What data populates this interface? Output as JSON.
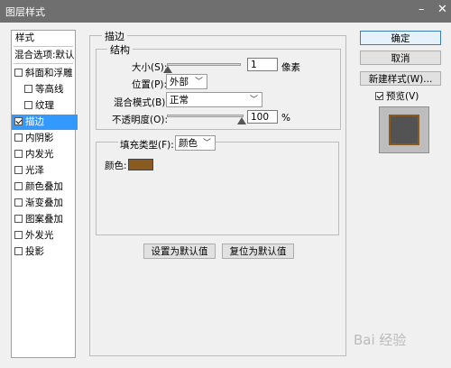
{
  "window": {
    "title": "图层样式",
    "minimize_glyph": "–",
    "close_glyph": "✕"
  },
  "sidebar": {
    "header": "样式",
    "blend_options": "混合选项:默认",
    "items": [
      {
        "label": "斜面和浮雕",
        "checked": false,
        "sub": false,
        "selected": false
      },
      {
        "label": "等高线",
        "checked": false,
        "sub": true,
        "selected": false
      },
      {
        "label": "纹理",
        "checked": false,
        "sub": true,
        "selected": false
      },
      {
        "label": "描边",
        "checked": true,
        "sub": false,
        "selected": true
      },
      {
        "label": "内阴影",
        "checked": false,
        "sub": false,
        "selected": false
      },
      {
        "label": "内发光",
        "checked": false,
        "sub": false,
        "selected": false
      },
      {
        "label": "光泽",
        "checked": false,
        "sub": false,
        "selected": false
      },
      {
        "label": "颜色叠加",
        "checked": false,
        "sub": false,
        "selected": false
      },
      {
        "label": "渐变叠加",
        "checked": false,
        "sub": false,
        "selected": false
      },
      {
        "label": "图案叠加",
        "checked": false,
        "sub": false,
        "selected": false
      },
      {
        "label": "外发光",
        "checked": false,
        "sub": false,
        "selected": false
      },
      {
        "label": "投影",
        "checked": false,
        "sub": false,
        "selected": false
      }
    ]
  },
  "stroke": {
    "section_title": "描边",
    "structure_title": "结构",
    "size_label": "大小(S):",
    "size_value": "1",
    "size_unit": "像素",
    "position_label": "位置(P):",
    "position_value": "外部",
    "blend_mode_label": "混合模式(B):",
    "blend_mode_value": "正常",
    "opacity_label": "不透明度(O):",
    "opacity_value": "100",
    "opacity_unit": "%",
    "fill_type_label": "填充类型(F):",
    "fill_type_value": "颜色",
    "color_label": "颜色:",
    "color": "#8b5a1e"
  },
  "buttons": {
    "set_default": "设置为默认值",
    "reset_default": "复位为默认值",
    "ok": "确定",
    "cancel": "取消",
    "new_style": "新建样式(W)...",
    "preview_label": "预览(V)"
  },
  "watermark": "Bai 经验",
  "colors": {
    "selection": "#3399ff",
    "titlebar": "#6f6f6f",
    "stroke_color": "#8b5a1e"
  }
}
